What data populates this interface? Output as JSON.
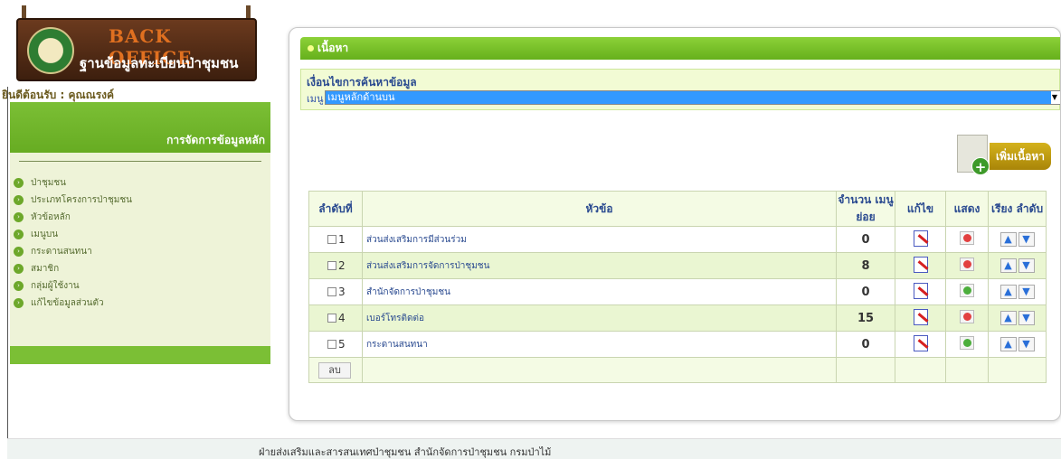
{
  "header": {
    "logo_title": "BACK OFFICE",
    "logo_subtitle": "ฐานข้อมูลทะเบียนป่าชุมชน",
    "welcome": "ยินดีต้อนรับ : คุณณรงค์"
  },
  "sidebar": {
    "title": "การจัดการข้อมูลหลัก",
    "items": [
      {
        "label": "ป่าชุมชน"
      },
      {
        "label": "ประเภทโครงการป่าชุมชน"
      },
      {
        "label": "หัวข้อหลัก"
      },
      {
        "label": "เมนูบน"
      },
      {
        "label": "กระดานสนทนา"
      },
      {
        "label": "สมาชิก"
      },
      {
        "label": "กลุ่มผู้ใช้งาน"
      },
      {
        "label": "แก้ไขข้อมูลส่วนตัว"
      }
    ]
  },
  "main": {
    "section_title": "เนื้อหา",
    "search": {
      "title": "เงื่อนไขการค้นหาข้อมูล",
      "menu_label": "เมนู :",
      "menu_selected": "เมนูหลักด้านบน"
    },
    "add_button": "เพิ่มเนื้อหา",
    "table": {
      "headers": {
        "no": "ลำดับที่",
        "title": "หัวข้อ",
        "count": "จำนวน เมนูย่อย",
        "edit": "แก้ไข",
        "show": "แสดง",
        "order": "เรียง ลำดับ"
      },
      "rows": [
        {
          "no": "1",
          "title": "ส่วนส่งเสริมการมีส่วนร่วม",
          "count": "0",
          "status": "red"
        },
        {
          "no": "2",
          "title": "ส่วนส่งเสริมการจัดการป่าชุมชน",
          "count": "8",
          "status": "red"
        },
        {
          "no": "3",
          "title": "สำนักจัดการป่าชุมชน",
          "count": "0",
          "status": "green"
        },
        {
          "no": "4",
          "title": "เบอร์โทรติดต่อ",
          "count": "15",
          "status": "red"
        },
        {
          "no": "5",
          "title": "กระดานสนทนา",
          "count": "0",
          "status": "green"
        }
      ],
      "delete_button": "ลบ"
    }
  },
  "footer": {
    "text": "ฝ่ายส่งเสริมและสารสนเทศป่าชุมชน สำนักจัดการป่าชุมชน กรมป่าไม้"
  },
  "colors": {
    "accent_green": "#67ac22",
    "link_blue": "#2a4a90",
    "selected_blue": "#3399ff"
  }
}
